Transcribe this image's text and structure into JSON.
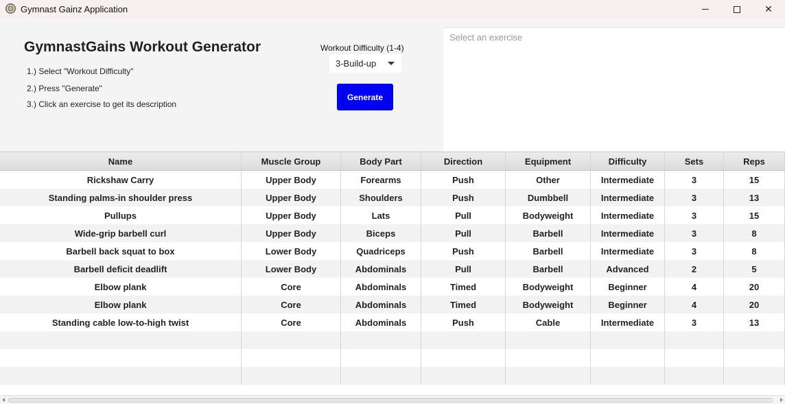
{
  "window": {
    "title": "Gymnast Gainz Application",
    "icons": {
      "app": "app-icon",
      "minimize": "minimize-icon",
      "maximize": "maximize-icon",
      "close": "close-icon"
    }
  },
  "header": {
    "title": "GymnastGains Workout Generator",
    "steps": [
      "1.) Select \"Workout Difficulty\"",
      "2.) Press \"Generate\"",
      "3.) Click an exercise to get its description"
    ],
    "difficulty_label": "Workout Difficulty (1-4)",
    "difficulty_value": "3-Build-up",
    "generate_label": "Generate"
  },
  "description": {
    "placeholder": "Select an exercise"
  },
  "colors": {
    "generate_button": "#0000f2"
  },
  "table": {
    "columns": [
      "Name",
      "Muscle Group",
      "Body Part",
      "Direction",
      "Equipment",
      "Difficulty",
      "Sets",
      "Reps"
    ],
    "rows": [
      [
        "Rickshaw Carry",
        "Upper Body",
        "Forearms",
        "Push",
        "Other",
        "Intermediate",
        "3",
        "15"
      ],
      [
        "Standing palms-in shoulder press",
        "Upper Body",
        "Shoulders",
        "Push",
        "Dumbbell",
        "Intermediate",
        "3",
        "13"
      ],
      [
        "Pullups",
        "Upper Body",
        "Lats",
        "Pull",
        "Bodyweight",
        "Intermediate",
        "3",
        "15"
      ],
      [
        "Wide-grip barbell curl",
        "Upper Body",
        "Biceps",
        "Pull",
        "Barbell",
        "Intermediate",
        "3",
        "8"
      ],
      [
        "Barbell back squat to box",
        "Lower Body",
        "Quadriceps",
        "Push",
        "Barbell",
        "Intermediate",
        "3",
        "8"
      ],
      [
        "Barbell deficit deadlift",
        "Lower Body",
        "Abdominals",
        "Pull",
        "Barbell",
        "Advanced",
        "2",
        "5"
      ],
      [
        "Elbow plank",
        "Core",
        "Abdominals",
        "Timed",
        "Bodyweight",
        "Beginner",
        "4",
        "20"
      ],
      [
        "Elbow plank",
        "Core",
        "Abdominals",
        "Timed",
        "Bodyweight",
        "Beginner",
        "4",
        "20"
      ],
      [
        "Standing cable low-to-high twist",
        "Core",
        "Abdominals",
        "Push",
        "Cable",
        "Intermediate",
        "3",
        "13"
      ]
    ]
  }
}
